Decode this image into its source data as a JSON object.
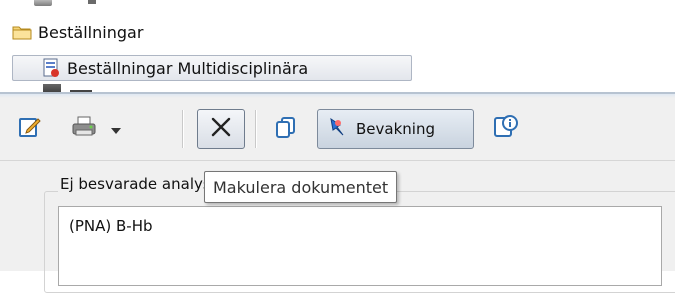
{
  "tree": {
    "items": [
      {
        "label": "Beställningar",
        "icon": "folder-icon"
      },
      {
        "label": "Beställningar Multidisciplinära",
        "icon": "order-document-icon"
      }
    ]
  },
  "toolbar": {
    "edit_icon": "edit-icon",
    "print_icon": "print-icon",
    "dropdown_icon": "chevron-down-icon",
    "cancel_icon": "close-icon",
    "copy_icon": "copy-icon",
    "watch_label": "Bevakning",
    "watch_icon": "pin-icon",
    "info_icon": "info-icon"
  },
  "tooltip": {
    "text": "Makulera dokumentet"
  },
  "panel": {
    "group_title": "Ej besvarade analyser",
    "items": [
      "(PNA) B-Hb"
    ]
  },
  "colors": {
    "folder": "#f2c94c",
    "pin": "#2a6fd6",
    "button_border": "#6f7c8d"
  }
}
